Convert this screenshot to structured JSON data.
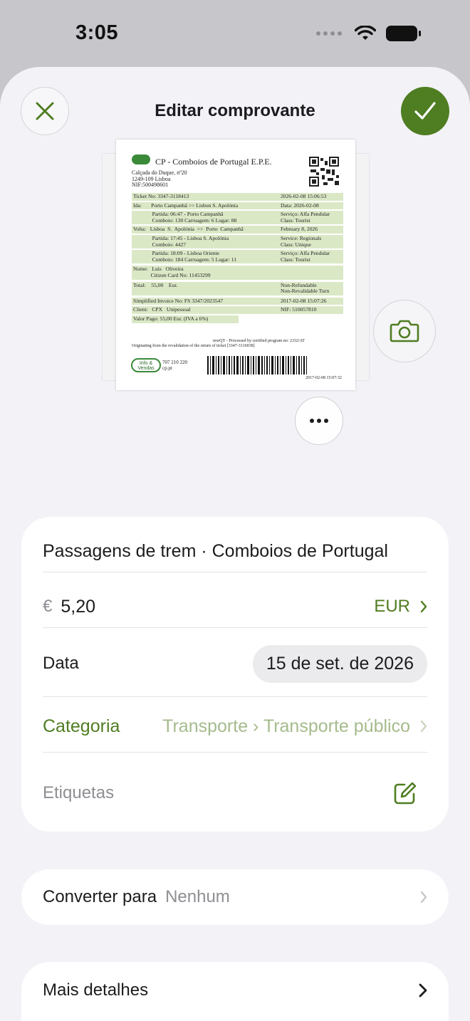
{
  "status_bar": {
    "time": "3:05"
  },
  "header": {
    "title": "Editar comprovante"
  },
  "receipt": {
    "company": "CP - Comboios de Portugal E.P.E.",
    "address_lines": [
      "Calçada do Duque, nº20",
      "1249-109 Lisboa",
      "NIF:500498601"
    ],
    "rows": [
      {
        "left": "Ticket No: 3347-3118413",
        "right": "2026-02-08 15:06:53"
      },
      {
        "left": "Ida:       Porto Campanhã >> Lisbon S. Apolónia",
        "right": "Data: 2026-02-08"
      },
      {
        "left": "              Partida: 06:47 - Porto Campanhã\n              Comboio: 130 Carruagem: 6 Lugar: 88",
        "right": "Serviço: Alfa Pendular\nClass: Tourist"
      },
      {
        "left": "Volta:   Lisboa  S.  Apolónia  >>  Porto  Campanhã",
        "right": "February 8, 2026"
      },
      {
        "left": "              Partida: 17:45 - Lisboa S. Apolónia\n              Comboio: 4427",
        "right": "Service: Regionals\nClass: Unique"
      },
      {
        "left": "              Partida: 18:09 - Lisboa Oriente\n              Comboio: 184 Carruagem: 5 Lugar: 11",
        "right": "Serviço: Alfa Pendular\nClass: Tourist"
      },
      {
        "left": "Nome:   Luis   Oliveira\n             Citizen Card No: 11453299",
        "right": ""
      },
      {
        "left": "Total:    55,00    Eur.",
        "right": "Non-Refundable\nNon-Revalidable Turn"
      },
      {
        "left": "Simplified Invoice No: FS 3347/2023547",
        "right": "2017-02-08 15:07:26"
      },
      {
        "left": "Client:   CPX   Unipessoal",
        "right": "NIF: 510057810"
      },
      {
        "left": "Valor Pago: 55,00 Eur. (IVA a 6%)",
        "right": ""
      }
    ],
    "footer_line1": "mwQY - Processed by certified program no: 2332/AT",
    "footer_line2": "Originating from the revalidation of the return of ticket [3347-3116038]",
    "info_logo_line1": "Info &",
    "info_logo_line2": "Vendas",
    "info_phone": "707 210 220",
    "info_site": "cp.pt",
    "stamp": "2017-02-08 15:07:32"
  },
  "form": {
    "description": "Passagens de trem · Comboios de Portugal",
    "currency_symbol": "€",
    "amount": "5,20",
    "currency_code": "EUR",
    "date_label": "Data",
    "date_value": "15 de set. de 2026",
    "category_label": "Categoria",
    "category_value": "Transporte › Transporte público",
    "tags_label": "Etiquetas",
    "convert_label": "Converter para",
    "convert_value": "Nenhum",
    "more_details_label": "Mais detalhes"
  },
  "colors": {
    "accent": "#4f7d22",
    "category_value": "#a5bb8c",
    "background": "#f2f2f7"
  },
  "icons": [
    "close-icon",
    "checkmark-icon",
    "camera-icon",
    "ellipsis-icon",
    "chevron-right-icon",
    "edit-icon",
    "wifi-icon",
    "battery-icon"
  ]
}
